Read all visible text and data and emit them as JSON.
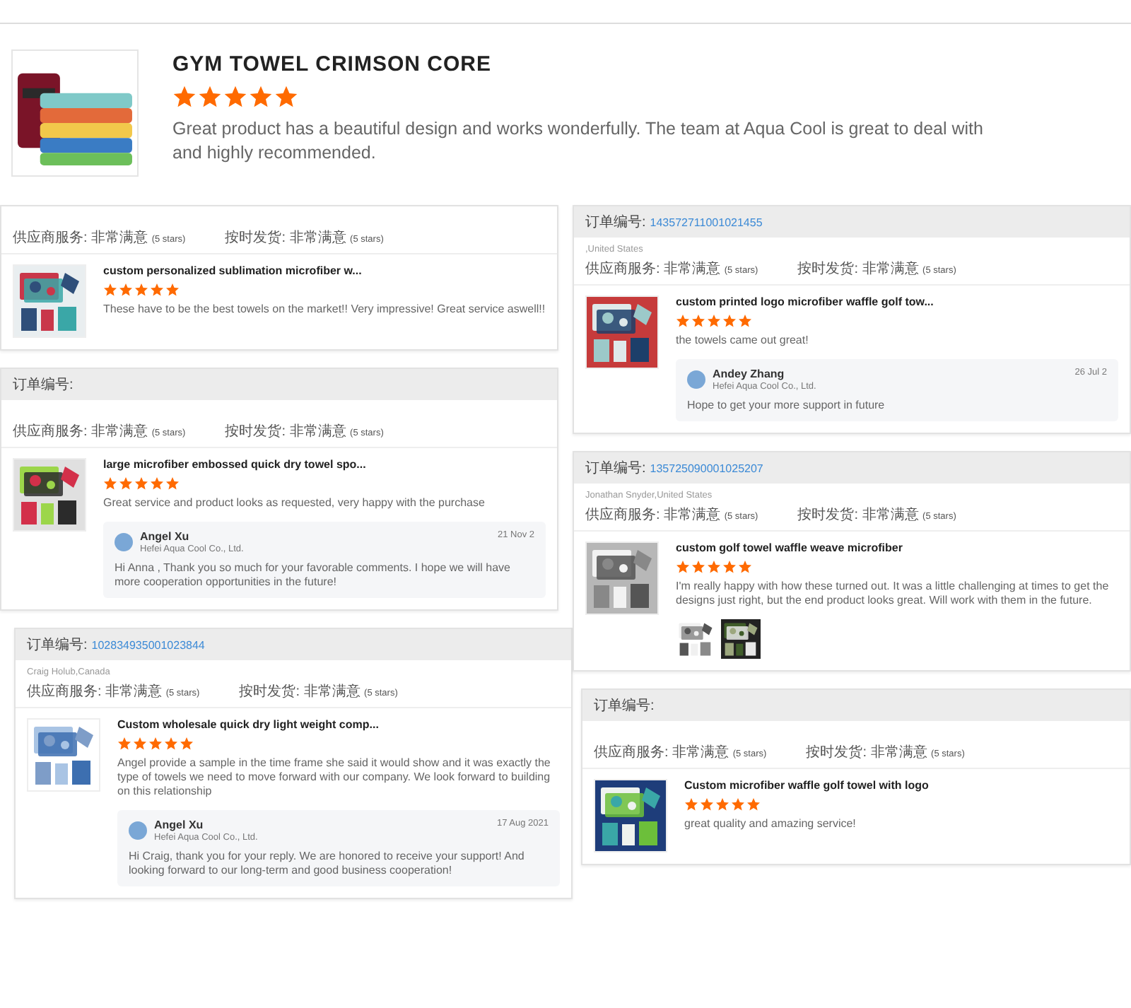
{
  "top_review": {
    "title": "GYM TOWEL CRIMSON CORE",
    "stars": 5,
    "text": "Great product has a beautiful design and works wonderfully. The team at Aqua Cool is great to deal with and highly recommended.",
    "image": {
      "kind": "picture"
    }
  },
  "columns": [
    [
      {
        "ratings": [
          {
            "label": "供应商服务:",
            "value": "非常满意",
            "note": "(5 stars)"
          },
          {
            "label": "按时发货:",
            "value": "非常满意",
            "note": "(5 stars)"
          }
        ],
        "product": "custom personalized sublimation microfiber w...",
        "stars": 5,
        "review": "These have to be the best towels on the market!! Very impressive! Great service aswell!!",
        "image": {
          "kind": "picture"
        }
      },
      {
        "order_label": "订单编号:",
        "ratings": [
          {
            "label": "供应商服务:",
            "value": "非常满意",
            "note": "(5 stars)"
          },
          {
            "label": "按时发货:",
            "value": "非常满意",
            "note": "(5 stars)"
          }
        ],
        "product": "large microfiber embossed quick dry towel spo...",
        "stars": 5,
        "review": "Great service and product looks as requested, very happy with the purchase",
        "image": {
          "kind": "picture"
        },
        "reply": {
          "name": "Angel Xu",
          "company": "Hefei Aqua Cool Co., Ltd.",
          "date": "21 Nov 2",
          "text": "Hi Anna , Thank you so much  for your favorable comments. I hope we will have more cooperation opportunities in the future!"
        }
      },
      {
        "order_label": "订单编号:",
        "order_number": "102834935001023844",
        "buyer": "Craig Holub,Canada",
        "ratings": [
          {
            "label": "供应商服务:",
            "value": "非常满意",
            "note": "(5 stars)"
          },
          {
            "label": "按时发货:",
            "value": "非常满意",
            "note": "(5 stars)"
          }
        ],
        "product": "Custom wholesale quick dry light weight comp...",
        "stars": 5,
        "review": "Angel provide a sample in the time frame she said it would show and it was exactly the type of towels we need to move forward with our company.  We look forward to building on this relationship",
        "image": {
          "kind": "picture"
        },
        "reply": {
          "name": "Angel Xu",
          "company": "Hefei Aqua Cool Co., Ltd.",
          "date": "17 Aug 2021",
          "text": "Hi Craig, thank you for your reply. We are honored to receive your support! And looking forward to our long-term and good business cooperation!"
        }
      }
    ],
    [
      {
        "order_label": "订单编号:",
        "order_number": "143572711001021455",
        "buyer": ",United States",
        "ratings": [
          {
            "label": "供应商服务:",
            "value": "非常满意",
            "note": "(5 stars)"
          },
          {
            "label": "按时发货:",
            "value": "非常满意",
            "note": "(5 stars)"
          }
        ],
        "product": "custom printed logo microfiber waffle golf tow...",
        "stars": 5,
        "review": "the towels came out great!",
        "image": {
          "kind": "picture"
        },
        "reply": {
          "name": "Andey Zhang",
          "company": "Hefei Aqua Cool Co., Ltd.",
          "date": "26 Jul 2",
          "text": "Hope to get your more support in future"
        }
      },
      {
        "order_label": "订单编号:",
        "order_number": "135725090001025207",
        "buyer": "Jonathan Snyder,United States",
        "ratings": [
          {
            "label": "供应商服务:",
            "value": "非常满意",
            "note": "(5 stars)"
          },
          {
            "label": "按时发货:",
            "value": "非常满意",
            "note": "(5 stars)"
          }
        ],
        "product": "custom golf towel waffle weave microfiber",
        "stars": 5,
        "review": "I'm really happy with how these turned out. It was a little challenging at times to get the designs just right, but the end product looks great. Will work with them in the future.",
        "image": {
          "kind": "picture"
        },
        "photos": [
          {
            "kind": "picture"
          },
          {
            "kind": "picture"
          }
        ]
      },
      {
        "order_label": "订单编号:",
        "ratings": [
          {
            "label": "供应商服务:",
            "value": "非常满意",
            "note": "(5 stars)"
          },
          {
            "label": "按时发货:",
            "value": "非常满意",
            "note": "(5 stars)"
          }
        ],
        "product": "Custom microfiber waffle golf towel with logo",
        "stars": 5,
        "review": "great quality and amazing service!",
        "image": {
          "kind": "picture"
        }
      }
    ]
  ]
}
